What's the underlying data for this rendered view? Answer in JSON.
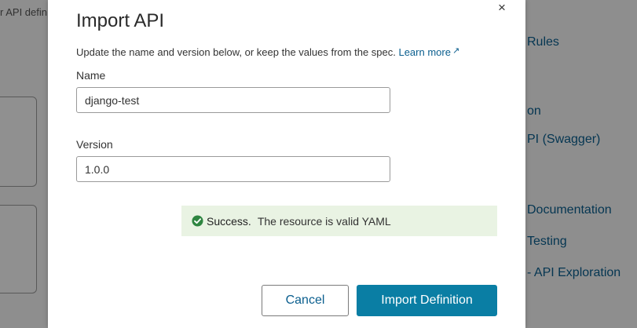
{
  "background": {
    "top_fragment": "r API defin",
    "links": [
      "Rules",
      "on",
      "PI (Swagger)",
      "Documentation",
      "Testing",
      "- API Exploration"
    ]
  },
  "modal": {
    "title": "Import API",
    "close_glyph": "×",
    "intro_text": "Update the name and version below, or keep the values from the spec. ",
    "learn_more": "Learn more",
    "learn_more_icon": "external-link-icon",
    "name_label": "Name",
    "name_value": "django-test",
    "version_label": "Version",
    "version_value": "1.0.0",
    "success": {
      "title": "Success.",
      "message": "The resource is valid YAML",
      "icon": "check-circle-icon",
      "color": "#2e8540"
    },
    "cancel_label": "Cancel",
    "import_label": "Import Definition"
  },
  "colors": {
    "primary": "#0a7ea4",
    "link": "#0a5e8e",
    "success_bg": "#e9f3e3"
  }
}
